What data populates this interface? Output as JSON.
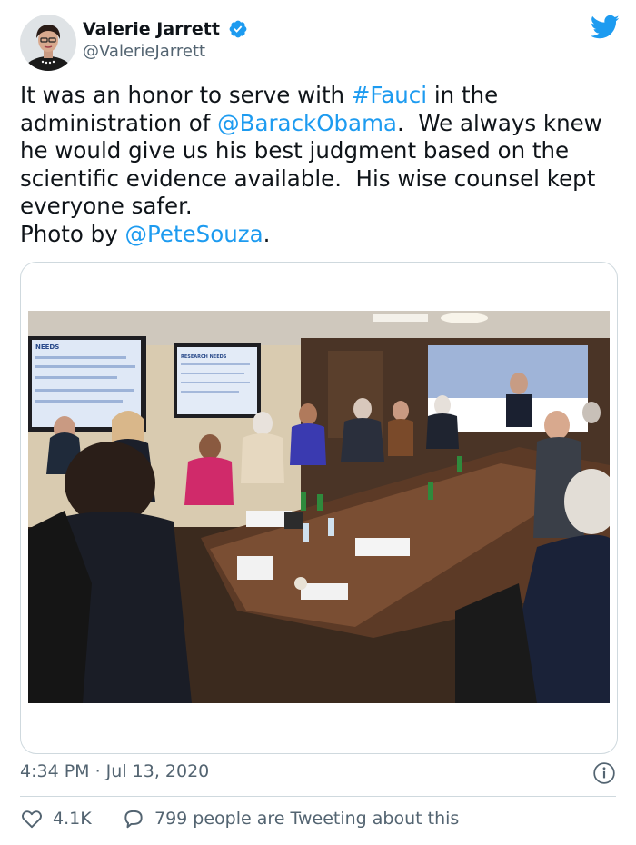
{
  "author": {
    "display_name": "Valerie Jarrett",
    "handle": "@ValerieJarrett",
    "verified": true
  },
  "tweet": {
    "segments": [
      {
        "text": "It was an honor to serve with ",
        "link": false
      },
      {
        "text": "#Fauci",
        "link": true
      },
      {
        "text": " in the administration of ",
        "link": false
      },
      {
        "text": "@BarackObama",
        "link": true
      },
      {
        "text": ".  We always knew he would give us his best judgment based on the scientific evidence available.  His wise counsel kept everyone safer.\nPhoto by ",
        "link": false
      },
      {
        "text": "@PeteSouza",
        "link": true
      },
      {
        "text": ".",
        "link": false
      }
    ]
  },
  "media": {
    "screens": {
      "left_heading": "NEEDS",
      "middle_heading": "RESEARCH NEEDS"
    }
  },
  "meta": {
    "timestamp": "4:34 PM · Jul 13, 2020"
  },
  "actions": {
    "likes": "4.1K",
    "conversation": "799 people are Tweeting about this"
  },
  "colors": {
    "link": "#1d9bf0",
    "muted": "#536471",
    "border": "#cfd9de",
    "twitter_blue": "#1d9bf0"
  },
  "icons": [
    "verified-badge-icon",
    "twitter-bird-icon",
    "info-icon",
    "heart-icon",
    "speech-bubble-icon"
  ]
}
